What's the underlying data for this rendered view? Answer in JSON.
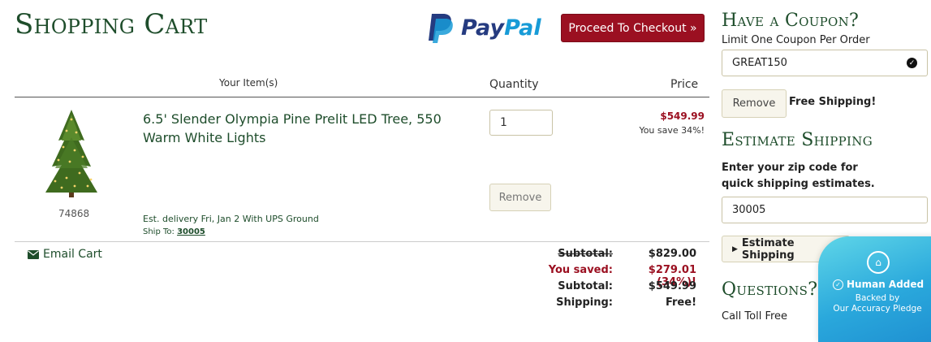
{
  "cart": {
    "title": "Shopping Cart",
    "paypal": {
      "pay": "Pay",
      "pal": "Pal"
    },
    "checkout_label": "Proceed To Checkout »",
    "columns": {
      "items": "Your Item(s)",
      "quantity": "Quantity",
      "price": "Price"
    },
    "item": {
      "name": "6.5' Slender Olympia Pine Prelit LED Tree, 550 Warm White Lights",
      "sku": "74868",
      "quantity": "1",
      "price": "$549.99",
      "savings": "You save 34%!",
      "remove_label": "Remove",
      "delivery": "Est. delivery Fri, Jan 2 With UPS Ground",
      "ship_to_label": "Ship To:",
      "ship_to_zip": "30005"
    },
    "email_cart_label": "Email Cart",
    "summary": [
      {
        "label": "Subtotal:",
        "value": "$829.00"
      },
      {
        "label": "You saved:",
        "value": "$279.01 (34%)!"
      },
      {
        "label": "Subtotal:",
        "value": "$549.99"
      },
      {
        "label": "Shipping:",
        "value": "Free!"
      }
    ]
  },
  "sidebar": {
    "coupon_title": "Have a Coupon?",
    "coupon_limit": "Limit One Coupon Per Order",
    "coupon_value": "GREAT150",
    "coupon_remove_label": "Remove",
    "coupon_status": "Free Shipping!",
    "estimate_title": "Estimate Shipping",
    "estimate_desc": "Enter your zip code for quick shipping estimates.",
    "zip_value": "30005",
    "estimate_button": "Estimate Shipping",
    "questions_title": "Questions?",
    "call_label": "Call Toll Free"
  },
  "badge": {
    "title": "Human Added",
    "line1": "Backed by",
    "line2": "Our Accuracy Pledge"
  },
  "colors": {
    "brand_green": "#1e4d2b",
    "checkout_red": "#9b1021",
    "paypal_dark": "#253b80",
    "paypal_light": "#179bd7"
  }
}
